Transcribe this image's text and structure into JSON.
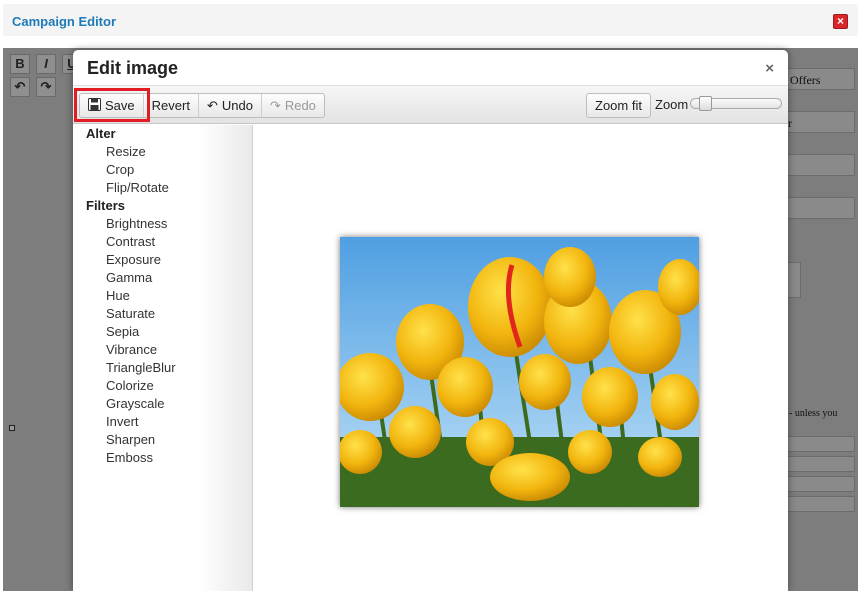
{
  "campaign": {
    "title": "Campaign Editor",
    "close_icon": "close-icon"
  },
  "background": {
    "toolbar": [
      "B",
      "I",
      "U",
      "↶",
      "↷"
    ],
    "right_labels": [
      "Offers",
      "r"
    ],
    "right_text": "- unless you"
  },
  "modal": {
    "title": "Edit image",
    "close": "×",
    "toolbar": {
      "save": "Save",
      "revert": "Revert",
      "undo": "Undo",
      "redo": "Redo",
      "zoom_fit": "Zoom fit",
      "zoom_label": "Zoom",
      "zoom_level": 0.1
    },
    "sidebar": {
      "alter_title": "Alter",
      "alter_items": [
        "Resize",
        "Crop",
        "Flip/Rotate"
      ],
      "filters_title": "Filters",
      "filter_items": [
        "Brightness",
        "Contrast",
        "Exposure",
        "Gamma",
        "Hue",
        "Saturate",
        "Sepia",
        "Vibrance",
        "TriangleBlur",
        "Colorize",
        "Grayscale",
        "Invert",
        "Sharpen",
        "Emboss"
      ]
    }
  },
  "colors": {
    "accent": "#1e7ab8",
    "highlight": "#e11d23",
    "close_red": "#d9262b"
  }
}
